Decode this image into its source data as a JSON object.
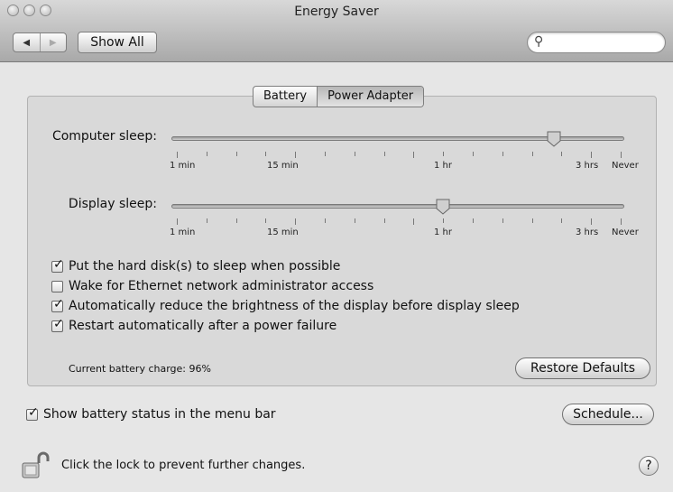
{
  "window": {
    "title": "Energy Saver"
  },
  "toolbar": {
    "back_icon": "back-arrow-icon",
    "forward_icon": "forward-arrow-icon",
    "show_all_label": "Show All",
    "search": {
      "icon": "search-icon",
      "value": ""
    }
  },
  "tabs": [
    {
      "label": "Battery",
      "selected": false
    },
    {
      "label": "Power Adapter",
      "selected": true
    }
  ],
  "computer_sleep": {
    "label": "Computer sleep:",
    "level": 0.85,
    "tick_labels": [
      "1 min",
      "15 min",
      "1 hr",
      "3 hrs",
      "Never"
    ]
  },
  "display_sleep": {
    "label": "Display sleep:",
    "level": 0.6,
    "tick_labels": [
      "1 min",
      "15 min",
      "1 hr",
      "3 hrs",
      "Never"
    ]
  },
  "options": [
    {
      "label": "Put the hard disk(s) to sleep when possible",
      "checked": true
    },
    {
      "label": "Wake for Ethernet network administrator access",
      "checked": false
    },
    {
      "label": "Automatically reduce the brightness of the display before display sleep",
      "checked": true
    },
    {
      "label": "Restart automatically after a power failure",
      "checked": true
    }
  ],
  "battery_charge_text": "Current battery charge: 96%",
  "restore_defaults_label": "Restore Defaults",
  "show_battery_status": {
    "label": "Show battery status in the menu bar",
    "checked": true
  },
  "schedule_label": "Schedule...",
  "lock": {
    "icon": "lock-icon",
    "text": "Click the lock to prevent further changes."
  },
  "help": {
    "label": "?"
  },
  "colors": {
    "window_bg": "#e6e6e6",
    "panel_bg": "#d9d9d9"
  }
}
